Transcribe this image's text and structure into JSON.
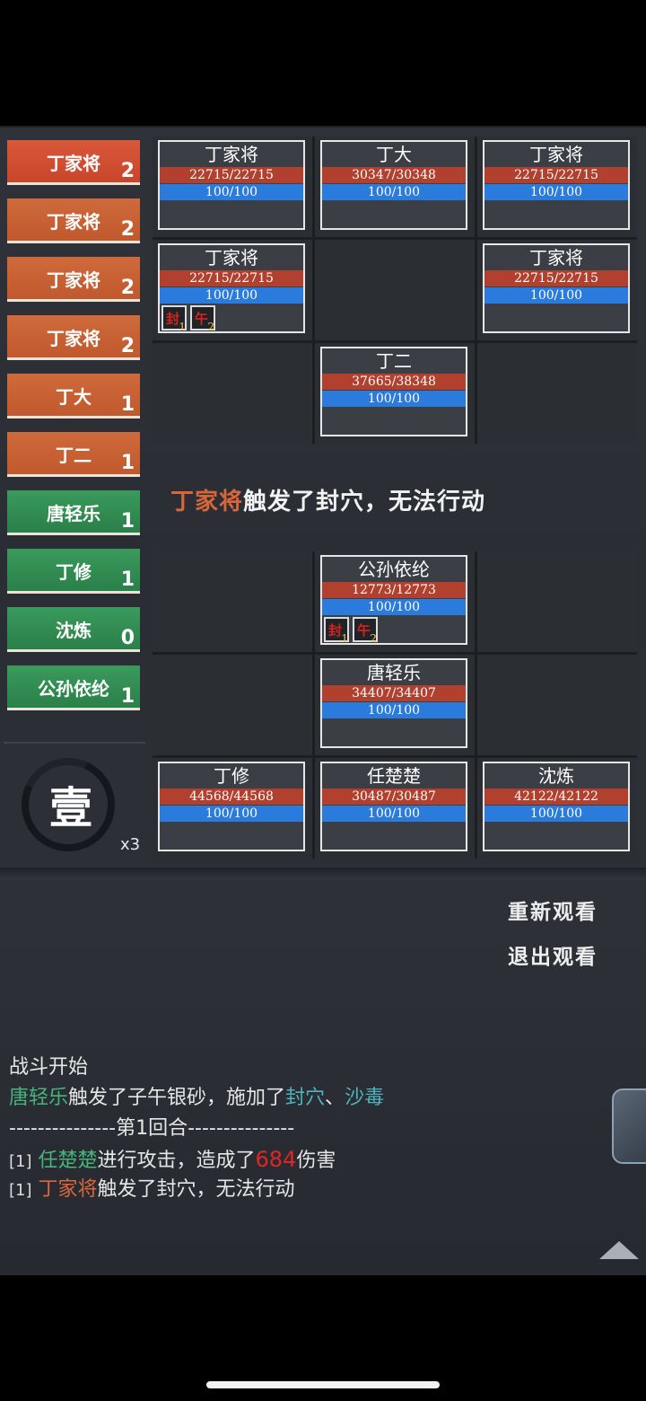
{
  "turn_order": [
    {
      "name": "丁家将",
      "count": "2",
      "side": "enemy",
      "active": true
    },
    {
      "name": "丁家将",
      "count": "2",
      "side": "enemy"
    },
    {
      "name": "丁家将",
      "count": "2",
      "side": "enemy"
    },
    {
      "name": "丁家将",
      "count": "2",
      "side": "enemy"
    },
    {
      "name": "丁大",
      "count": "1",
      "side": "enemy"
    },
    {
      "name": "丁二",
      "count": "1",
      "side": "enemy"
    },
    {
      "name": "唐轻乐",
      "count": "1",
      "side": "ally"
    },
    {
      "name": "丁修",
      "count": "1",
      "side": "ally"
    },
    {
      "name": "沈炼",
      "count": "0",
      "side": "ally"
    },
    {
      "name": "公孙依纶",
      "count": "1",
      "side": "ally"
    }
  ],
  "round": {
    "glyph": "壹",
    "speed": "x3"
  },
  "enemy_grid": [
    {
      "name": "丁家将",
      "hp": "22715/22715",
      "mp": "100/100"
    },
    {
      "name": "丁大",
      "hp": "30347/30348",
      "mp": "100/100"
    },
    {
      "name": "丁家将",
      "hp": "22715/22715",
      "mp": "100/100"
    },
    {
      "name": "丁家将",
      "hp": "22715/22715",
      "mp": "100/100",
      "status": [
        {
          "glyph": "封",
          "num": "1"
        },
        {
          "glyph": "午",
          "num": "2"
        }
      ]
    },
    null,
    {
      "name": "丁家将",
      "hp": "22715/22715",
      "mp": "100/100"
    },
    null,
    {
      "name": "丁二",
      "hp": "37665/38348",
      "mp": "100/100"
    },
    null
  ],
  "ally_grid": [
    null,
    {
      "name": "公孙依纶",
      "hp": "12773/12773",
      "mp": "100/100",
      "status": [
        {
          "glyph": "封",
          "num": "1"
        },
        {
          "glyph": "午",
          "num": "2"
        }
      ]
    },
    null,
    null,
    {
      "name": "唐轻乐",
      "hp": "34407/34407",
      "mp": "100/100"
    },
    null,
    {
      "name": "丁修",
      "hp": "44568/44568",
      "mp": "100/100"
    },
    {
      "name": "任楚楚",
      "hp": "30487/30487",
      "mp": "100/100"
    },
    {
      "name": "沈炼",
      "hp": "42122/42122",
      "mp": "100/100"
    }
  ],
  "center_message": {
    "actor": "丁家将",
    "text": "触发了封穴，无法行动"
  },
  "buttons": {
    "replay": "重新观看",
    "exit": "退出观看"
  },
  "log": {
    "line1": "战斗开始",
    "line2": {
      "actor": "唐轻乐",
      "text1": "触发了子午银砂，施加了",
      "skill1": "封穴",
      "sep": "、",
      "skill2": "沙毒"
    },
    "line3": "---------------第1回合---------------",
    "line4": {
      "idx": "[1]",
      "actor": "任楚楚",
      "text1": "进行攻击，造成了",
      "damage": "684",
      "text2": "伤害"
    },
    "line5": {
      "idx": "[1]",
      "actor": "丁家将",
      "text1": "触发了封穴，无法行动"
    }
  }
}
